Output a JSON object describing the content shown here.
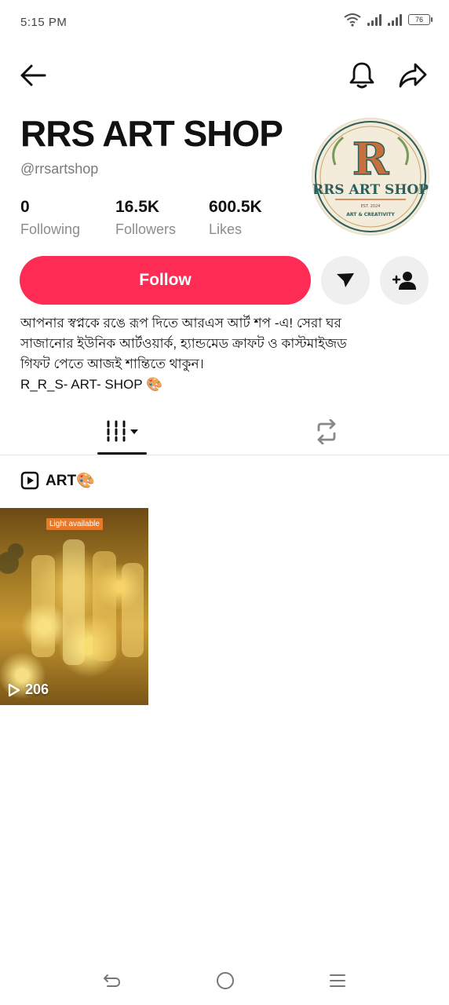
{
  "status_bar": {
    "time": "5:15 PM",
    "battery": "76"
  },
  "icons": {
    "back": "arrow-left-icon",
    "bell": "bell-icon",
    "share": "share-arrow-icon",
    "message": "send-message-icon",
    "add_friend": "add-user-icon",
    "videos_tab": "grid-videos-icon",
    "reposts_tab": "repost-icon",
    "playlist": "play-square-icon",
    "play": "play-icon"
  },
  "profile": {
    "name": "RRS ART SHOP",
    "handle": "@rrsartshop",
    "stats": [
      {
        "value": "0",
        "label": "Following"
      },
      {
        "value": "16.5K",
        "label": "Followers"
      },
      {
        "value": "600.5K",
        "label": "Likes"
      }
    ],
    "avatar": {
      "monogram": "R",
      "title": "RRS ART SHOP",
      "est": "EST. 2024",
      "tagline": "ART & CREATIVITY"
    }
  },
  "actions": {
    "follow_label": "Follow"
  },
  "bio": {
    "lines": [
      "আপনার স্বপ্নকে রঙে রূপ দিতে আরএস আর্ট শপ -এ! সেরা ঘর",
      "সাজানোর ইউনিক আর্টওয়ার্ক, হ্যান্ডমেড ক্রাফট ও কাস্টমাইজড",
      "গিফট পেতে আজই শান্তিতে থাকুন।",
      "R_R_S- ART- SHOP 🎨"
    ]
  },
  "tabs": {
    "active": "videos"
  },
  "playlist": {
    "label": "ART🎨"
  },
  "videos": [
    {
      "tag": "Light available",
      "views": "206"
    }
  ],
  "colors": {
    "accent": "#fe2c55",
    "text": "#111111",
    "muted": "#8c8c8c"
  }
}
